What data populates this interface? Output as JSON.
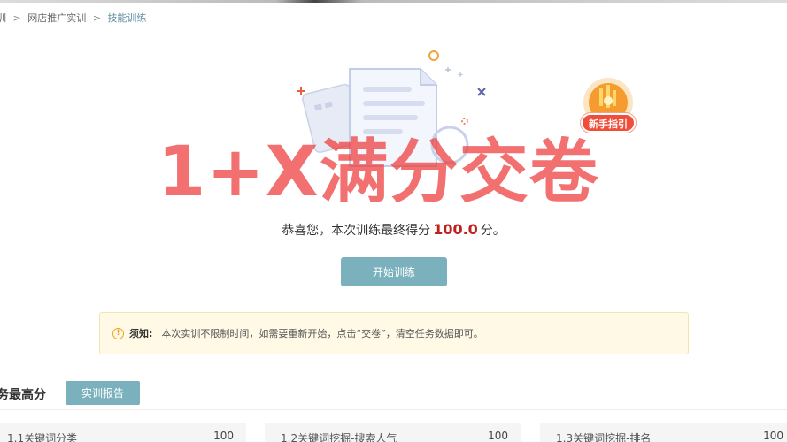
{
  "breadcrumb": {
    "items": [
      "训",
      "网店推广实训",
      "技能训练"
    ],
    "separator": ">"
  },
  "guide_badge": {
    "label": "新手指引"
  },
  "watermark": {
    "text": "1+X满分交卷"
  },
  "result": {
    "prefix": "恭喜您，本次训练最终得分",
    "score": "100.0",
    "suffix": "分。"
  },
  "start_button": {
    "label": "开始训练"
  },
  "notice": {
    "title": "须知:",
    "text": "本次实训不限制时间，如需要重新开始，点击“交卷”，清空任务数据即可。"
  },
  "tasks_section": {
    "title": "务最高分",
    "report_button": "实训报告",
    "tasks": [
      {
        "name": "1.1关键词分类",
        "score": "100"
      },
      {
        "name": "1.2关键词挖掘-搜索人气",
        "score": "100"
      },
      {
        "name": "1.3关键词挖掘-排名",
        "score": "100"
      }
    ]
  },
  "colors": {
    "accent": "#7ab1bc",
    "score": "#c0201d",
    "watermark": "#ee3a3a",
    "notice_bg": "#fff9e6",
    "badge": "#ef4e3a"
  }
}
